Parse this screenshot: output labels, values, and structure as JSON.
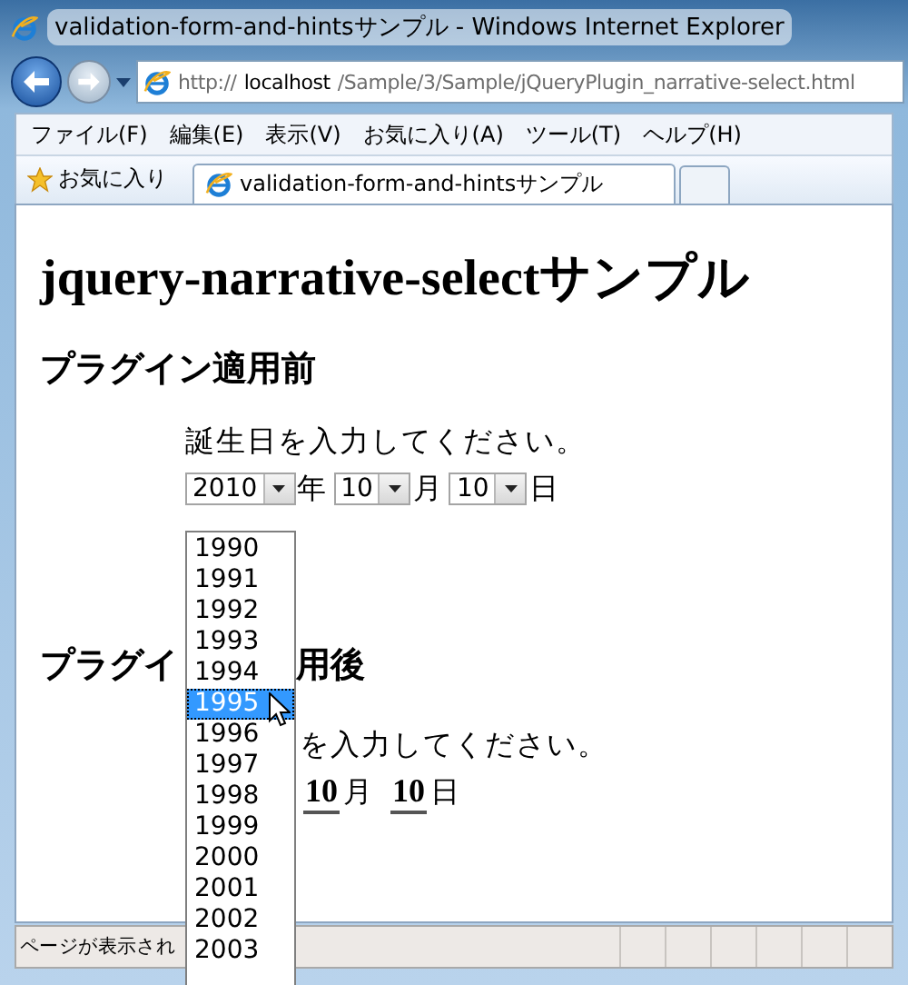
{
  "window": {
    "title": "validation-form-and-hintsサンプル - Windows Internet Explorer"
  },
  "address_bar": {
    "scheme": "http://",
    "host": "localhost",
    "path": "/Sample/3/Sample/jQueryPlugin_narrative-select.html"
  },
  "menu_bar": [
    "ファイル(F)",
    "編集(E)",
    "表示(V)",
    "お気に入り(A)",
    "ツール(T)",
    "ヘルプ(H)"
  ],
  "favorites_bar": {
    "label": "お気に入り",
    "tabs": [
      {
        "label": "validation-form-and-hintsサンプル",
        "selected": true
      }
    ]
  },
  "page": {
    "title": "jquery-narrative-selectサンプル",
    "before": {
      "heading": "プラグイン適用前",
      "prompt": "誕生日を入力してください。",
      "selects": [
        {
          "value": "2010",
          "unit": "年"
        },
        {
          "value": "10",
          "unit": "月"
        },
        {
          "value": "10",
          "unit": "日"
        }
      ]
    },
    "after": {
      "heading_parts": [
        "プラグイ",
        "用後"
      ],
      "prompt": "を入力してください。",
      "fields": [
        {
          "value": "10",
          "unit": "月"
        },
        {
          "value": "10",
          "unit": "日"
        }
      ]
    },
    "dropdown": {
      "options": [
        {
          "label": "1990",
          "selected": false
        },
        {
          "label": "1991",
          "selected": false
        },
        {
          "label": "1992",
          "selected": false
        },
        {
          "label": "1993",
          "selected": false
        },
        {
          "label": "1994",
          "selected": false
        },
        {
          "label": "1995",
          "selected": true
        },
        {
          "label": "1996",
          "selected": false
        },
        {
          "label": "1997",
          "selected": false
        },
        {
          "label": "1998",
          "selected": false
        },
        {
          "label": "1999",
          "selected": false
        },
        {
          "label": "2000",
          "selected": false
        },
        {
          "label": "2001",
          "selected": false
        },
        {
          "label": "2002",
          "selected": false
        },
        {
          "label": "2003",
          "selected": false
        }
      ]
    }
  },
  "status_bar": {
    "text": "ページが表示され"
  }
}
